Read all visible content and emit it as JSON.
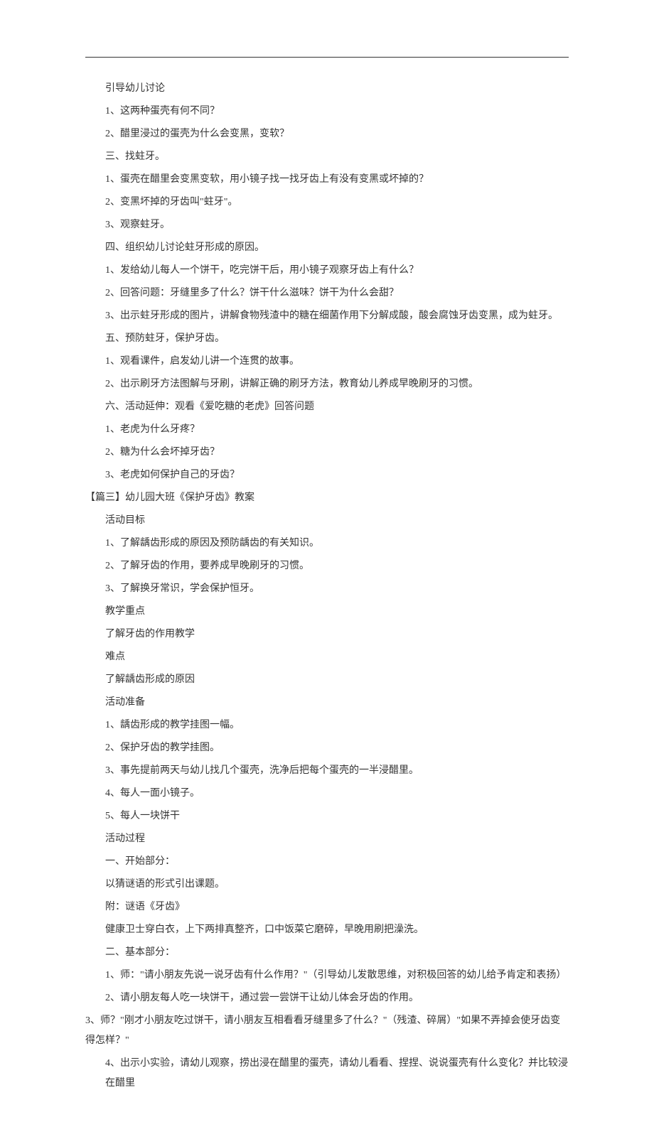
{
  "lines": [
    {
      "text": "引导幼儿讨论",
      "indent": 1
    },
    {
      "text": "1、这两种蛋壳有何不同？",
      "indent": 1
    },
    {
      "text": "2、醋里浸过的蛋壳为什么会变黑，变软？",
      "indent": 1
    },
    {
      "text": "三、找蛀牙。",
      "indent": 1
    },
    {
      "text": "1、蛋壳在醋里会变黑变软，用小镜子找一找牙齿上有没有变黑或坏掉的？",
      "indent": 1
    },
    {
      "text": "2、变黑坏掉的牙齿叫\"蛀牙\"。",
      "indent": 1
    },
    {
      "text": "3、观察蛀牙。",
      "indent": 1
    },
    {
      "text": "四、组织幼儿讨论蛀牙形成的原因。",
      "indent": 1
    },
    {
      "text": "1、发给幼儿每人一个饼干，吃完饼干后，用小镜子观察牙齿上有什么？",
      "indent": 1
    },
    {
      "text": "2、回答问题：牙缝里多了什么？饼干什么滋味？饼干为什么会甜？",
      "indent": 1
    },
    {
      "text": "3、出示蛀牙形成的图片，讲解食物残渣中的糖在细菌作用下分解成酸，酸会腐蚀牙齿变黑，成为蛀牙。",
      "indent": 1
    },
    {
      "text": "五、预防蛀牙，保护牙齿。",
      "indent": 1
    },
    {
      "text": "1、观看课件，启发幼儿讲一个连贯的故事。",
      "indent": 1
    },
    {
      "text": "2、出示刷牙方法图解与牙刷，讲解正确的刷牙方法，教育幼儿养成早晚刷牙的习惯。",
      "indent": 1
    },
    {
      "text": "六、活动延伸：观看《爱吃糖的老虎》回答问题",
      "indent": 1
    },
    {
      "text": "1、老虎为什么牙疼？",
      "indent": 1
    },
    {
      "text": "2、糖为什么会坏掉牙齿？",
      "indent": 1
    },
    {
      "text": "3、老虎如何保护自己的牙齿？",
      "indent": 1
    },
    {
      "text": "【篇三】幼儿园大班《保护牙齿》教案",
      "indent": 0
    },
    {
      "text": "活动目标",
      "indent": 1
    },
    {
      "text": "1、了解龋齿形成的原因及预防龋齿的有关知识。",
      "indent": 1
    },
    {
      "text": "2、了解牙齿的作用，要养成早晚刷牙的习惯。",
      "indent": 1
    },
    {
      "text": "3、了解换牙常识，学会保护恒牙。",
      "indent": 1
    },
    {
      "text": "教学重点",
      "indent": 1
    },
    {
      "text": "了解牙齿的作用教学",
      "indent": 1
    },
    {
      "text": "难点",
      "indent": 1
    },
    {
      "text": "了解龋齿形成的原因",
      "indent": 1
    },
    {
      "text": "活动准备",
      "indent": 1
    },
    {
      "text": "1、龋齿形成的教学挂图一幅。",
      "indent": 1
    },
    {
      "text": "2、保护牙齿的教学挂图。",
      "indent": 1
    },
    {
      "text": "3、事先提前两天与幼儿找几个蛋壳，洗净后把每个蛋壳的一半浸醋里。",
      "indent": 1
    },
    {
      "text": "4、每人一面小镜子。",
      "indent": 1
    },
    {
      "text": "5、每人一块饼干",
      "indent": 1
    },
    {
      "text": "活动过程",
      "indent": 1
    },
    {
      "text": "一、开始部分：",
      "indent": 1
    },
    {
      "text": "以猜谜语的形式引出课题。",
      "indent": 1
    },
    {
      "text": "附：谜语《牙齿》",
      "indent": 1
    },
    {
      "text": "健康卫士穿白衣，上下两排真整齐，口中饭菜它磨碎，早晚用刷把澡洗。",
      "indent": 1
    },
    {
      "text": "二、基本部分：",
      "indent": 1
    },
    {
      "text": "1、师：\"请小朋友先说一说牙齿有什么作用？\"（引导幼儿发散思维，对积极回答的幼儿给予肯定和表扬）",
      "indent": 1
    },
    {
      "text": "2、请小朋友每人吃一块饼干，通过尝一尝饼干让幼儿体会牙齿的作用。",
      "indent": 1
    },
    {
      "text": "3、师？\"刚才小朋友吃过饼干，请小朋友互相看看牙缝里多了什么？\"（残渣、碎屑）\"如果不弄掉会使牙齿变得怎样？\"",
      "indent": 0,
      "continue": true
    },
    {
      "text": "4、出示小实验，请幼儿观察，捞出浸在醋里的蛋壳，请幼儿看看、捏捏、说说蛋壳有什么变化？并比较浸在醋里",
      "indent": 1
    }
  ]
}
